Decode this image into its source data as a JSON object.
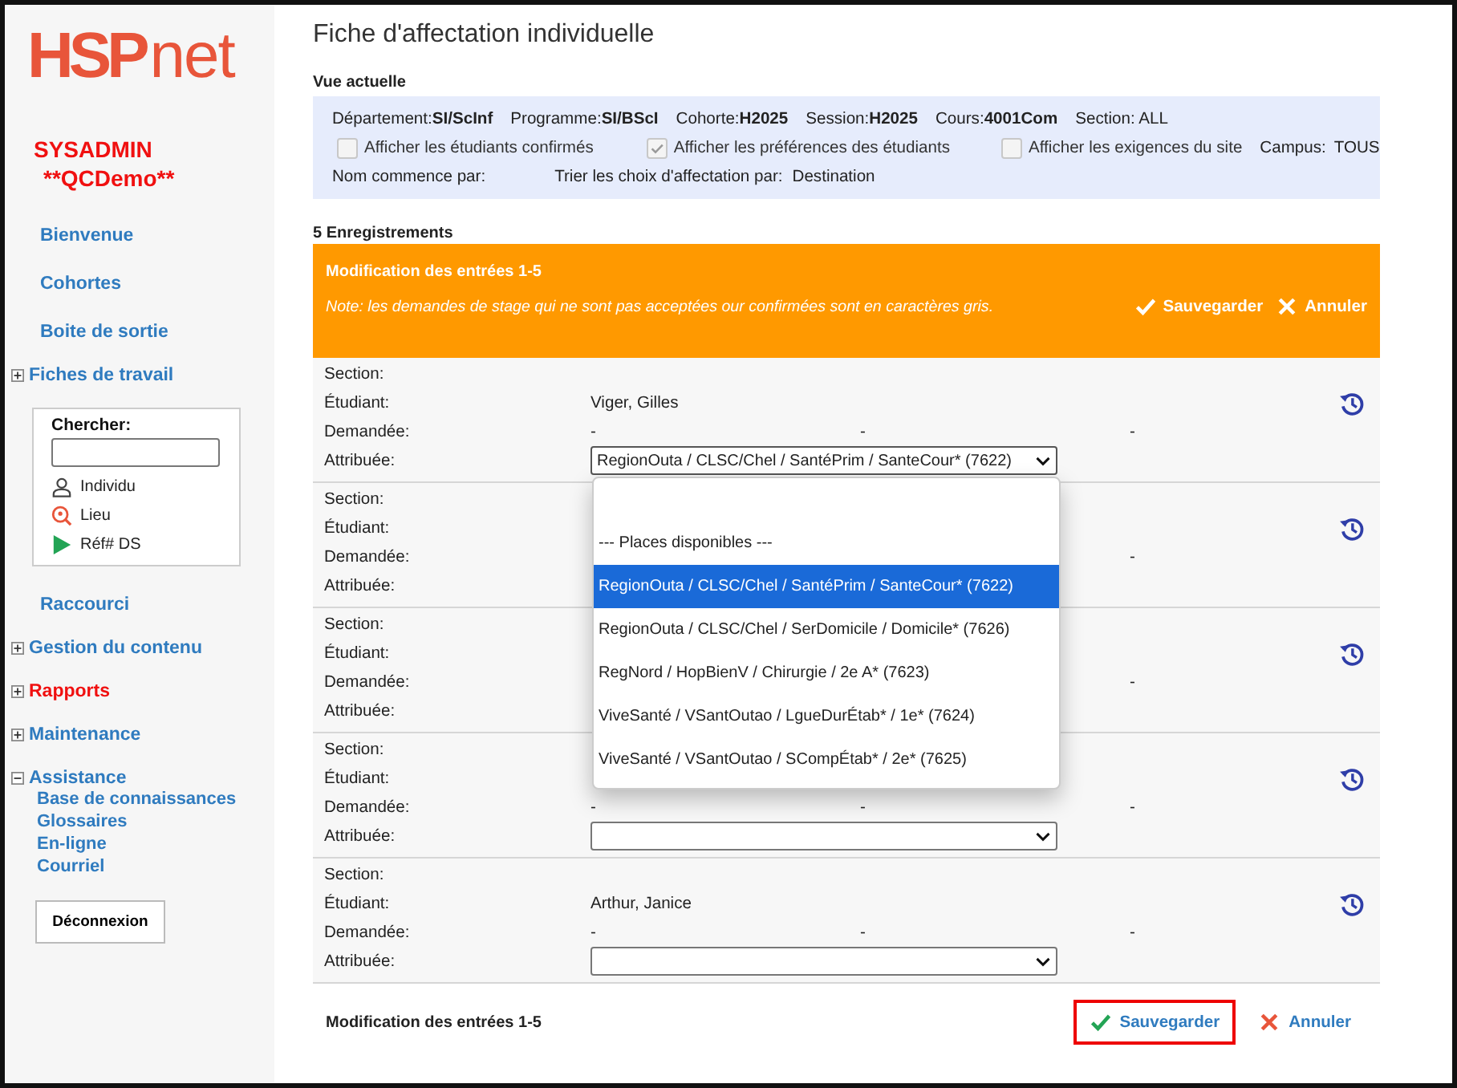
{
  "logo": {
    "text": "HSP",
    "suffix": "net"
  },
  "user": {
    "name": "SYSADMIN",
    "org": "**QCDemo**"
  },
  "sidebar": {
    "items": [
      {
        "label": "Bienvenue",
        "kind": "link"
      },
      {
        "label": "Cohortes",
        "kind": "link"
      },
      {
        "label": "Boite de sortie",
        "kind": "link"
      },
      {
        "label": "Fiches de travail",
        "kind": "section",
        "expanded": false
      },
      {
        "kind": "search",
        "label": "Chercher:",
        "options": [
          {
            "label": "Individu",
            "kind": "person"
          },
          {
            "label": "Lieu",
            "kind": "place"
          },
          {
            "label": "Réf# DS",
            "kind": "play"
          }
        ]
      },
      {
        "label": "Raccourci",
        "kind": "link"
      },
      {
        "label": "Gestion du contenu",
        "kind": "section",
        "expanded": false
      },
      {
        "label": "Rapports",
        "kind": "section",
        "expanded": false,
        "highlight": true
      },
      {
        "label": "Maintenance",
        "kind": "section",
        "expanded": false
      },
      {
        "label": "Assistance",
        "kind": "section",
        "expanded": true,
        "children": [
          "Base de connaissances",
          "Glossaires",
          "En-ligne",
          "Courriel"
        ]
      }
    ],
    "logout": "Déconnexion"
  },
  "page": {
    "title": "Fiche d'affectation individuelle"
  },
  "view": {
    "title": "Vue actuelle",
    "fields": [
      {
        "label": "Département:",
        "value": "SI/ScInf"
      },
      {
        "label": "Programme:",
        "value": "SI/BScI"
      },
      {
        "label": "Cohorte:",
        "value": "H2025"
      },
      {
        "label": "Session:",
        "value": "H2025"
      },
      {
        "label": "Cours:",
        "value": "4001Com"
      },
      {
        "label": "Section: ALL"
      }
    ],
    "checks": [
      {
        "label": "Afficher les étudiants confirmés",
        "checked": false
      },
      {
        "label": "Afficher les préférences des étudiants",
        "checked": true
      },
      {
        "label": "Afficher les exigences du site",
        "checked": false
      }
    ],
    "campus": {
      "label": "Campus:",
      "value": "TOUS"
    },
    "name_filter": "Nom commence par:",
    "sort": {
      "label": "Trier les choix d'affectation par:",
      "value": "Destination"
    }
  },
  "records": {
    "count": "5 Enregistrements",
    "header": {
      "title": "Modification des entrées 1-5",
      "note": "Note: les demandes de stage qui ne sont pas acceptées our confirmées sont en caractères gris.",
      "save": "Sauvegarder",
      "cancel": "Annuler"
    },
    "rows": [
      {
        "labels": {
          "section": "Section:",
          "student": "Étudiant:",
          "requested": "Demandée:",
          "assigned": "Attribuée:"
        },
        "student": "Viger, Gilles",
        "requested_1": "-",
        "requested_2": "-",
        "requested_3": "-",
        "assigned": {
          "value": "RegionOuta / CLSC/Chel / SantéPrim / SanteCour* (7622)",
          "open": true
        }
      },
      {
        "labels": {
          "section": "Section:",
          "student": "Étudiant:",
          "requested": "Demandée:",
          "assigned": "Attribuée:"
        },
        "requested_3": "-"
      },
      {
        "labels": {
          "section": "Section:",
          "student": "Étudiant:",
          "requested": "Demandée:",
          "assigned": "Attribuée:"
        },
        "requested_3": "-"
      },
      {
        "labels": {
          "section": "Section:",
          "student": "Étudiant:",
          "requested": "Demandée:",
          "assigned": "Attribuée:"
        },
        "requested_1": "-",
        "requested_2": "-",
        "requested_3": "-",
        "assigned": {
          "open": false
        }
      },
      {
        "labels": {
          "section": "Section:",
          "student": "Étudiant:",
          "requested": "Demandée:",
          "assigned": "Attribuée:"
        },
        "student": "Arthur, Janice",
        "requested_1": "-",
        "requested_2": "-",
        "requested_3": "-",
        "assigned": {
          "open": false
        }
      }
    ],
    "dropdown": [
      {
        "label": "--- Places disponibles ---",
        "selected": false
      },
      {
        "label": "RegionOuta / CLSC/Chel / SantéPrim / SanteCour* (7622)",
        "selected": true
      },
      {
        "label": "RegionOuta / CLSC/Chel / SerDomicile / Domicile* (7626)",
        "selected": false
      },
      {
        "label": "RegNord / HopBienV / Chirurgie / 2e A* (7623)",
        "selected": false
      },
      {
        "label": "ViveSanté / VSantOutao / LgueDurÉtab* / 1e* (7624)",
        "selected": false
      },
      {
        "label": "ViveSanté / VSantOutao / SCompÉtab* / 2e* (7625)",
        "selected": false
      }
    ],
    "footer": {
      "title": "Modification des entrées 1-5",
      "save": "Sauvegarder",
      "cancel": "Annuler",
      "save_highlighted": true
    }
  }
}
